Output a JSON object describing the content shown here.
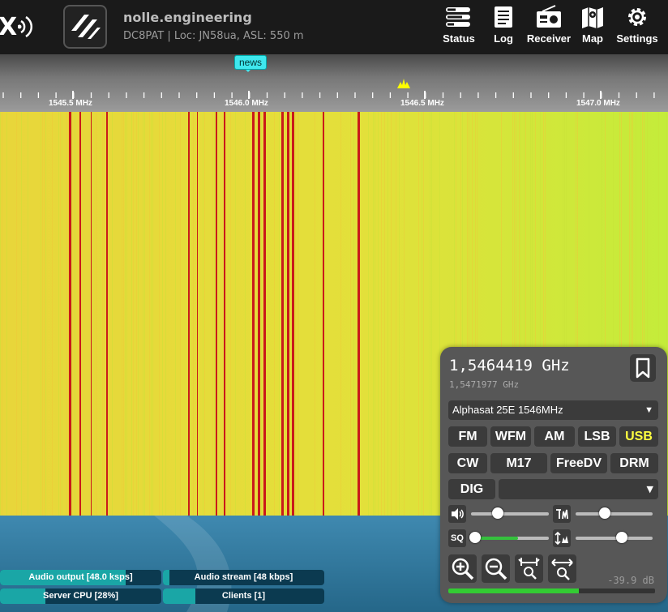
{
  "header": {
    "brand_text": "X",
    "title": "nolle.engineering",
    "description": "DC8PAT | Loc: JN58ua, ASL: 550 m",
    "nav": [
      {
        "label": "Status",
        "icon": "status-icon"
      },
      {
        "label": "Log",
        "icon": "log-icon"
      },
      {
        "label": "Receiver",
        "icon": "receiver-icon"
      },
      {
        "label": "Map",
        "icon": "map-icon"
      },
      {
        "label": "Settings",
        "icon": "gear-icon"
      }
    ]
  },
  "scale": {
    "labels": [
      "1545.5 MHz",
      "1546.0 MHz",
      "1546.5 MHz",
      "1547.0 MHz"
    ],
    "news_label": "news",
    "marker_color": "#ffff00"
  },
  "waterfall": {
    "background": "#d9e33a",
    "line_color": "#c91a1a"
  },
  "status_bars": {
    "audio_output": {
      "label": "Audio output [48.0 ksps]",
      "level": 0.78
    },
    "audio_stream": {
      "label": "Audio stream [48 kbps]",
      "level": 0.04
    },
    "server_cpu": {
      "label": "Server CPU [28%]",
      "level": 0.28
    },
    "clients": {
      "label": "Clients [1]",
      "level": 0.2
    }
  },
  "panel": {
    "frequency": "1,5464419 GHz",
    "offset_frequency": "1,5471977 GHz",
    "profile": "Alphasat 25E 1546MHz",
    "modes_row1": [
      "FM",
      "WFM",
      "AM",
      "LSB",
      "USB"
    ],
    "modes_row2": [
      "CW",
      "M17",
      "FreeDV",
      "DRM"
    ],
    "modes_row3": [
      "DIG"
    ],
    "active_mode": "USB",
    "digital_mode": "",
    "volume": 0.34,
    "squelch": 0.0,
    "squelch_level": 0.6,
    "nr": 0.38,
    "gain": 0.6,
    "squelch_label": "SQ",
    "db_value": "-39.9 dB",
    "smeter_level": 0.63,
    "accent_color": "#ffff40"
  }
}
